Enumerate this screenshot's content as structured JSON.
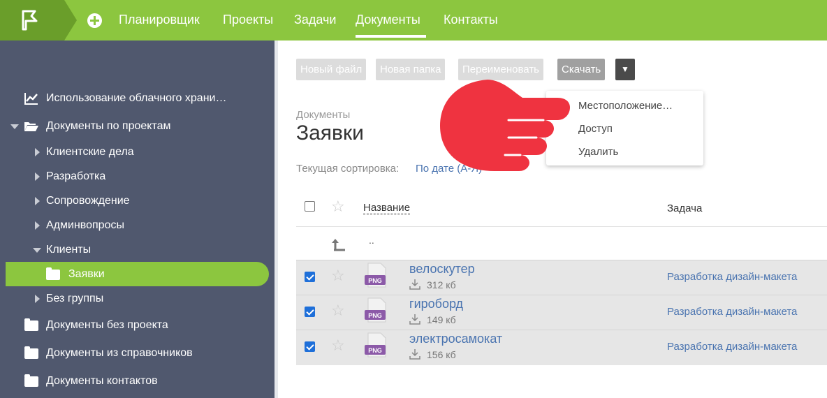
{
  "nav": {
    "items": [
      "Планировщик",
      "Проекты",
      "Задачи",
      "Документы",
      "Контакты"
    ],
    "active": "Документы",
    "logo_icon": "flag-logo-icon",
    "add_icon": "plus-circle-icon"
  },
  "sidebar": {
    "items": [
      {
        "label": "Использование облачного храни…",
        "icon": "chart-icon"
      },
      {
        "label": "Документы по проектам",
        "icon": "open-folder-icon"
      },
      {
        "label": "Клиентские дела"
      },
      {
        "label": "Разработка"
      },
      {
        "label": "Сопровождение"
      },
      {
        "label": "Админвопросы"
      },
      {
        "label": "Клиенты"
      },
      {
        "label": "Заявки",
        "icon": "folder-icon"
      },
      {
        "label": "Без группы"
      },
      {
        "label": "Документы без проекта",
        "icon": "folder-icon"
      },
      {
        "label": "Документы из справочников",
        "icon": "folder-icon"
      },
      {
        "label": "Документы контактов",
        "icon": "folder-icon"
      }
    ],
    "active": "Заявки"
  },
  "toolbar": {
    "new_file": "Новый файл",
    "new_folder": "Новая папка",
    "rename": "Переименовать",
    "download": "Скачать",
    "more": "▼"
  },
  "dropdown": {
    "items": [
      "Местоположение…",
      "Доступ",
      "Удалить"
    ]
  },
  "breadcrumb": "Документы",
  "title": "Заявки",
  "sort": {
    "label": "Текущая сортировка:",
    "value": "По дате (А-Я)"
  },
  "table": {
    "columns": [
      "Название",
      "Задача"
    ],
    "parent_link": "..",
    "rows": [
      {
        "name": "велоскутер",
        "size": "312 кб",
        "task": "Разработка дизайн-макета",
        "type": "PNG",
        "checked": true
      },
      {
        "name": "гироборд",
        "size": "149 кб",
        "task": "Разработка дизайн-макета",
        "type": "PNG",
        "checked": true
      },
      {
        "name": "электросамокат",
        "size": "156 кб",
        "task": "Разработка дизайн-макета",
        "type": "PNG",
        "checked": true
      }
    ]
  },
  "colors": {
    "brand_green": "#8cc63f",
    "sidebar_bg": "#50586e",
    "link_blue": "#4a74b0",
    "checkbox_blue": "#1e6fd9",
    "pointer_red": "#ef3340"
  }
}
